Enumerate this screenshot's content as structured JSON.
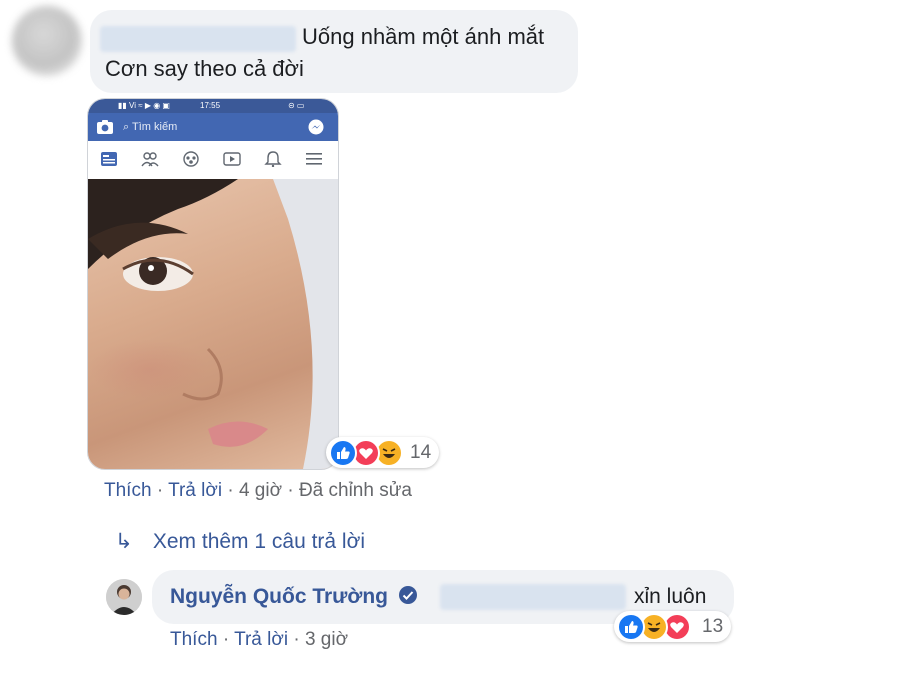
{
  "comment": {
    "line1": "Uống nhầm một ánh mắt",
    "line2": "Cơn say theo cả đời",
    "attachment": {
      "status_time": "17:55",
      "search_placeholder": "Tìm kiếm"
    },
    "reactions": {
      "count": "14",
      "types": [
        "like-icon",
        "love-icon",
        "haha-icon"
      ]
    },
    "actions": {
      "like": "Thích",
      "reply": "Trả lời",
      "time": "4 giờ",
      "edited": "Đã chỉnh sửa",
      "sep": "·"
    }
  },
  "view_more": {
    "icon": "↳",
    "label": "Xem thêm 1 câu trả lời"
  },
  "reply": {
    "author": "Nguyễn Quốc Trường",
    "text": "xỉn luôn",
    "reactions": {
      "count": "13",
      "types": [
        "like-icon",
        "haha-icon",
        "love-icon"
      ]
    },
    "actions": {
      "like": "Thích",
      "reply": "Trả lời",
      "time": "3 giờ",
      "sep": "·"
    }
  },
  "colors": {
    "link": "#385898",
    "bubble": "#f0f2f5",
    "fb_blue": "#4267b2",
    "love": "#f33e58",
    "haha": "#f7b125"
  }
}
